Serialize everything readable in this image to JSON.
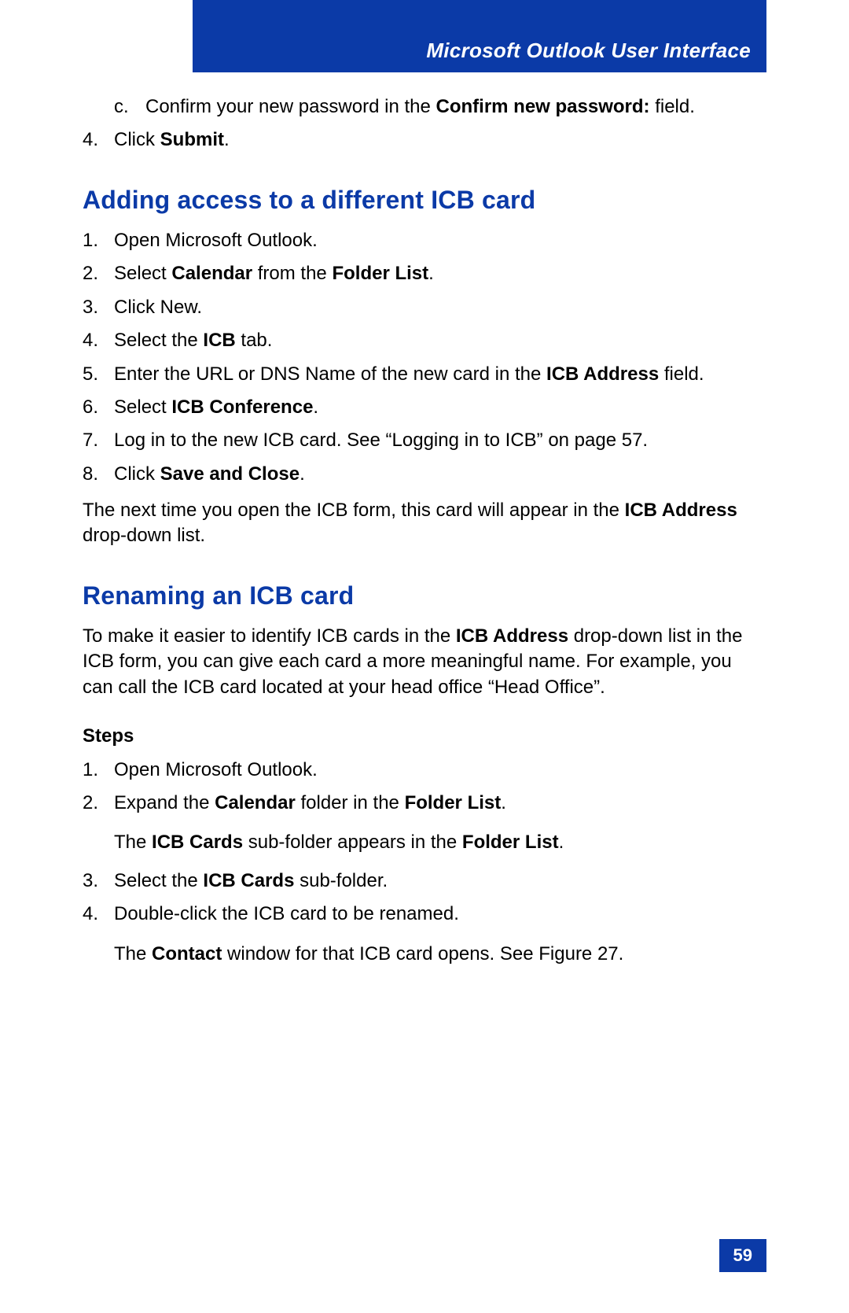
{
  "header": {
    "title": "Microsoft Outlook User Interface"
  },
  "top": {
    "c_marker": "c.",
    "c_1": "Confirm your new password in the ",
    "c_b1": "Confirm new password:",
    "c_2": " field.",
    "s4_marker": "4.",
    "s4_1": "Click ",
    "s4_b1": "Submit",
    "s4_2": "."
  },
  "adding": {
    "heading": "Adding access to a different ICB card",
    "s1_marker": "1.",
    "s1_t": "Open Microsoft Outlook.",
    "s2_marker": "2.",
    "s2_1": "Select ",
    "s2_b1": "Calendar",
    "s2_2": " from the ",
    "s2_b2": "Folder List",
    "s2_3": ".",
    "s3_marker": "3.",
    "s3_t": "Click New.",
    "s4_marker": "4.",
    "s4_1": "Select the ",
    "s4_b1": "ICB",
    "s4_2": " tab.",
    "s5_marker": "5.",
    "s5_1": "Enter the URL or DNS Name of the new card in the ",
    "s5_b1": "ICB Address",
    "s5_2": " field.",
    "s6_marker": "6.",
    "s6_1": "Select ",
    "s6_b1": "ICB Conference",
    "s6_2": ".",
    "s7_marker": "7.",
    "s7_t": "Log in to the new ICB card. See “Logging in to ICB” on page 57.",
    "s8_marker": "8.",
    "s8_1": "Click ",
    "s8_b1": "Save and Close",
    "s8_2": ".",
    "p_1": "The next time you open the ICB form, this card will appear in the ",
    "p_b1": "ICB Address",
    "p_2": " drop-down list."
  },
  "renaming": {
    "heading": "Renaming an ICB card",
    "intro_1": "To make it easier to identify ICB cards in the ",
    "intro_b1": "ICB Address",
    "intro_2": " drop-down list in the ICB form, you can give each card a more meaningful name. For example, you can call the ICB card located at your head office “Head Office”.",
    "steps_label": "Steps",
    "s1_marker": "1.",
    "s1_t": "Open Microsoft Outlook.",
    "s2_marker": "2.",
    "s2_1": "Expand the ",
    "s2_b1": "Calendar",
    "s2_2": " folder in the ",
    "s2_b2": "Folder List",
    "s2_3": ".",
    "s2c_1": "The ",
    "s2c_b1": "ICB Cards",
    "s2c_2": " sub-folder appears in the ",
    "s2c_b2": "Folder List",
    "s2c_3": ".",
    "s3_marker": "3.",
    "s3_1": "Select the ",
    "s3_b1": "ICB Cards",
    "s3_2": " sub-folder.",
    "s4_marker": "4.",
    "s4_t": "Double-click the ICB card to be renamed.",
    "s4c_1": "The ",
    "s4c_b1": "Contact",
    "s4c_2": " window for that ICB card opens. See Figure 27."
  },
  "footer": {
    "page": "59"
  }
}
